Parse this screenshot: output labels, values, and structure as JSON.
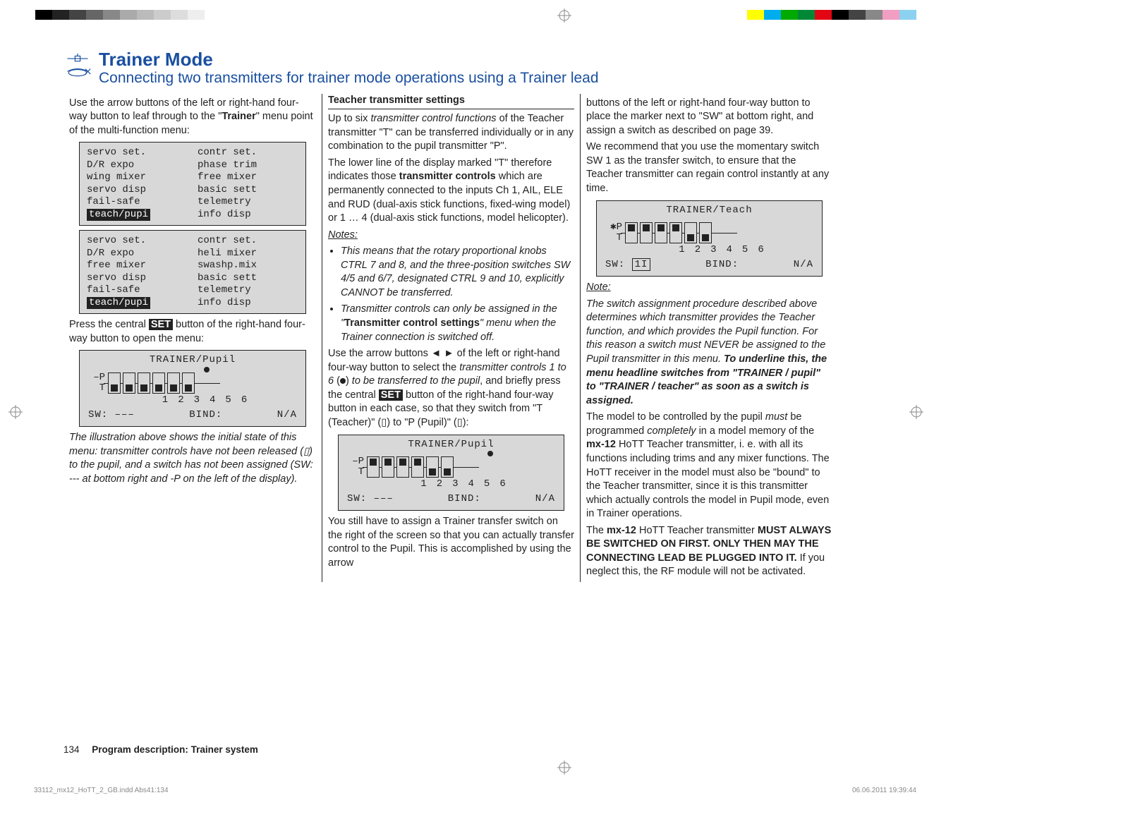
{
  "header": {
    "title": "Trainer Mode",
    "subtitle": "Connecting two transmitters for trainer mode operations using a Trainer lead"
  },
  "col1": {
    "intro_pre": "Use the arrow buttons of the left or right-hand four-way button to leaf through to the \"",
    "intro_bold": "Trainer",
    "intro_post": "\" menu point of the multi-function menu:",
    "menu_a": {
      "l1a": "servo set.",
      "l1b": "contr set.",
      "l2a": "D/R expo",
      "l2b": "phase trim",
      "l3a": "wing mixer",
      "l3b": "free mixer",
      "l4a": "servo disp",
      "l4b": "basic sett",
      "l5a": "fail-safe",
      "l5b": "telemetry",
      "l6a": "teach/pupi",
      "l6b": "info disp"
    },
    "menu_b": {
      "l1a": "servo set.",
      "l1b": "contr set.",
      "l2a": "D/R expo",
      "l2b": "heli mixer",
      "l3a": "free mixer",
      "l3b": "swashp.mix",
      "l4a": "servo disp",
      "l4b": "basic sett",
      "l5a": "fail-safe",
      "l5b": "telemetry",
      "l6a": "teach/pupi",
      "l6b": "info disp"
    },
    "press_pre": "Press the central ",
    "set_label": "SET",
    "press_post": " button of the right-hand four-way button to open the menu:",
    "screen1": {
      "title": "TRAINER/Pupil",
      "left_top": "–P",
      "left_bot": "T",
      "n1": "1",
      "n2": "2",
      "n3": "3",
      "n4": "4",
      "n5": "5",
      "n6": "6",
      "sw": "SW: –––",
      "bind": "BIND:",
      "na": "N/A"
    },
    "caption_s1": "The illustration above shows the initial state of this menu: transmitter controls have not been released (",
    "caption_s1_sym": "▯",
    "caption_s1b": ") to the pupil, and a switch has not been assigned (SW: --- at bottom right and -P on the left of the display)."
  },
  "col2": {
    "sec_head": "Teacher transmitter settings",
    "p1a": "Up to six ",
    "p1b": "transmitter control functions",
    "p1c": " of the Teacher transmitter \"T\" can be transferred individually or in any combination to the pupil transmitter \"P\".",
    "p2a": "The lower line of the display marked \"T\" therefore indicates those ",
    "p2b": "transmitter controls",
    "p2c": " which are permanently connected to the inputs Ch 1, AIL, ELE and RUD (dual-axis stick functions, fixed-wing model) or 1 … 4 (dual-axis stick functions, model helicopter).",
    "notes": "Notes:",
    "li1": "This means that the rotary proportional knobs CTRL 7 and 8, and the three-position switches SW 4/5 and 6/7, designated CTRL 9 and 10, explicitly CANNOT be transferred.",
    "li2a": "Transmitter controls can only be assigned in the \"",
    "li2b": "Transmitter control settings",
    "li2c": "\" menu when the Trainer connection is switched off.",
    "p3a": "Use the arrow buttons ◄ ► of the left or right-hand four-way button to select the ",
    "p3b": "transmitter controls 1 to 6",
    "p3c": " (",
    "p3d": ") ",
    "p3e": "to be transferred to the pupil",
    "p3f": ", and briefly press the central ",
    "set_label": "SET",
    "p3g": " button of the right-hand four-way button in each case, so that they switch from \"T (Teacher)\" (",
    "sym_t": "▯",
    "p3h": ") to \"P (Pupil)\" (",
    "sym_p": "▯",
    "p3i": "):",
    "screen2": {
      "title": "TRAINER/Pupil",
      "left_top": "–P",
      "left_bot": "T",
      "n1": "1",
      "n2": "2",
      "n3": "3",
      "n4": "4",
      "n5": "5",
      "n6": "6",
      "sw": "SW: –––",
      "bind": "BIND:",
      "na": "N/A"
    },
    "p4": "You still have to assign a Trainer transfer switch on the right of the screen so that you can actually transfer control to the Pupil. This is accomplished by using the arrow"
  },
  "col3": {
    "p1": "buttons of the left or right-hand four-way button to place the marker next to \"SW\" at bottom right, and assign a switch as described on page 39.",
    "p2": "We recommend that you use the momentary switch SW 1 as the transfer switch, to ensure that the Teacher transmitter can regain control instantly at any time.",
    "screen3": {
      "title": "TRAINER/Teach",
      "left_top": "✱P",
      "left_bot": "T",
      "n1": "1",
      "n2": "2",
      "n3": "3",
      "n4": "4",
      "n5": "5",
      "n6": "6",
      "sw_pre": "SW:",
      "sw_val": "1I",
      "bind": "BIND:",
      "na": "N/A"
    },
    "note_head": "Note:",
    "note_body_a": "The switch assignment procedure described above determines which transmitter provides the Teacher function, and which provides the Pupil function. For this reason a switch must NEVER be assigned to the Pupil transmitter in this menu. ",
    "note_body_b": "To underline this, the menu headline switches from \"TRAINER / pupil\" to \"TRAINER / teacher\" as soon as a switch is assigned.",
    "p3a": "The model to be controlled by the pupil ",
    "p3b": "must",
    "p3c": " be programmed ",
    "p3d": "completely",
    "p3e": " in a model memory of the ",
    "p3f": "mx-12",
    "p3g": " HoTT Teacher transmitter, i. e. with all its functions including trims and any mixer functions. The HoTT receiver in the model must also be \"bound\" to the Teacher transmitter, since it is this transmitter which actually controls the model in Pupil mode, even in Trainer operations.",
    "p4a": "The ",
    "p4b": "mx-12",
    "p4c": " HoTT Teacher transmitter ",
    "p4d": "MUST ALWAYS BE SWITCHED ON FIRST. ONLY THEN MAY THE CONNECTING LEAD BE PLUGGED INTO IT.",
    "p4e": " If you neglect this, the RF module will not be activated."
  },
  "footer": {
    "page": "134",
    "title": "Program description: Trainer system"
  },
  "indd": {
    "left": "33112_mx12_HoTT_2_GB.indd   Abs41:134",
    "right": "06.06.2011   19:39:44"
  }
}
